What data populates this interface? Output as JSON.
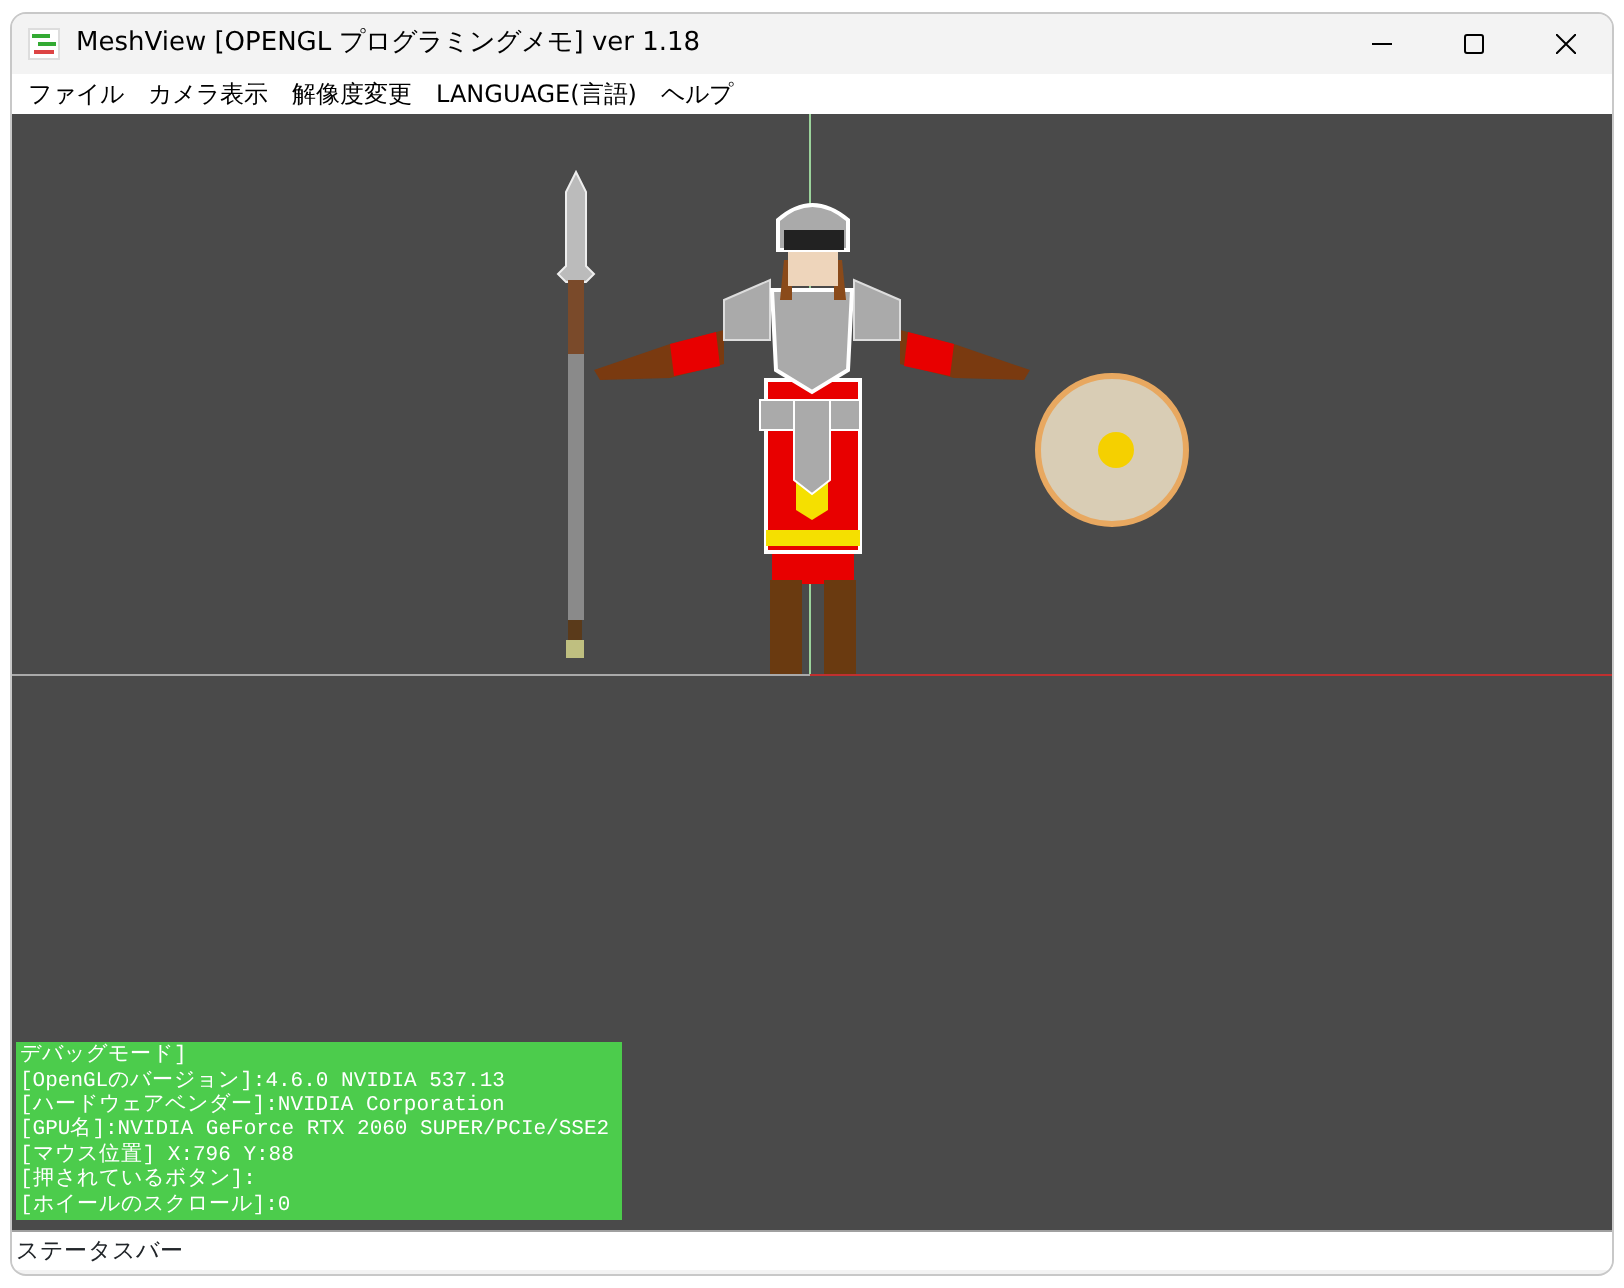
{
  "window": {
    "title": "MeshView [OPENGL プログラミングメモ] ver 1.18"
  },
  "menu": [
    "ファイル",
    "カメラ表示",
    "解像度変更",
    "LANGUAGE(言語)",
    "ヘルプ"
  ],
  "debug_panel": {
    "lines": [
      "デバッグモード]",
      "[OpenGLのバージョン]:4.6.0 NVIDIA 537.13",
      "[ハードウェアベンダー]:NVIDIA Corporation",
      "[GPU名]:NVIDIA GeForce RTX 2060 SUPER/PCIe/SSE2",
      "[マウス位置] X:796 Y:88",
      "[押されているボタン]:",
      "[ホイールのスクロール]:0"
    ]
  },
  "status_bar": {
    "text": "ステータスバー"
  }
}
